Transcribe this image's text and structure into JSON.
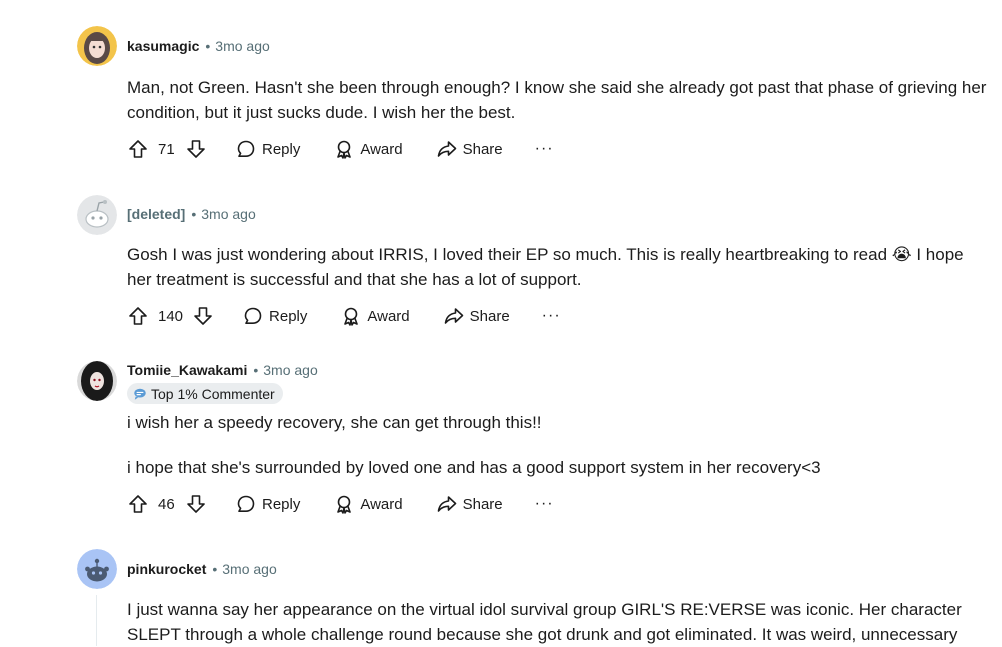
{
  "comments": [
    {
      "author": "kasumagic",
      "time": "3mo ago",
      "text": [
        "Man, not Green. Hasn't she been through enough? I know she said she already got past that phase of grieving her condition, but it just sucks dude. I wish her the best."
      ],
      "votes": "71",
      "reply_label": "Reply",
      "award_label": "Award",
      "share_label": "Share",
      "more_label": "···"
    },
    {
      "author": "[deleted]",
      "time": "3mo ago",
      "text": [
        "Gosh I was just wondering about IRRIS, I loved their EP so much. This is really heartbreaking to read 😭 I hope her treatment is successful and that she has a lot of support."
      ],
      "votes": "140",
      "reply_label": "Reply",
      "award_label": "Award",
      "share_label": "Share",
      "more_label": "···"
    },
    {
      "author": "Tomiie_Kawakami",
      "time": "3mo ago",
      "flair": "Top 1% Commenter",
      "text": [
        "i wish her a speedy recovery, she can get through this!!",
        "i hope that she's surrounded by loved one and has a good support system in her recovery<3"
      ],
      "votes": "46",
      "reply_label": "Reply",
      "award_label": "Award",
      "share_label": "Share",
      "more_label": "···"
    },
    {
      "author": "pinkurocket",
      "time": "3mo ago",
      "text": [
        "I just wanna say her appearance on the virtual idol survival group GIRL'S RE:VERSE was iconic. Her character SLEPT through a whole challenge round because she got drunk and got eliminated. It was weird, unnecessary"
      ]
    }
  ],
  "separator": "•",
  "icons": {
    "upvote": "upvote-arrow-icon",
    "downvote": "downvote-arrow-icon",
    "reply": "speech-bubble-icon",
    "award": "award-ribbon-icon",
    "share": "share-arrow-icon",
    "flair": "commenter-badge-icon"
  },
  "colors": {
    "meta": "#576f76",
    "text": "#1c1c1c",
    "flair_bg": "#eaedef"
  }
}
